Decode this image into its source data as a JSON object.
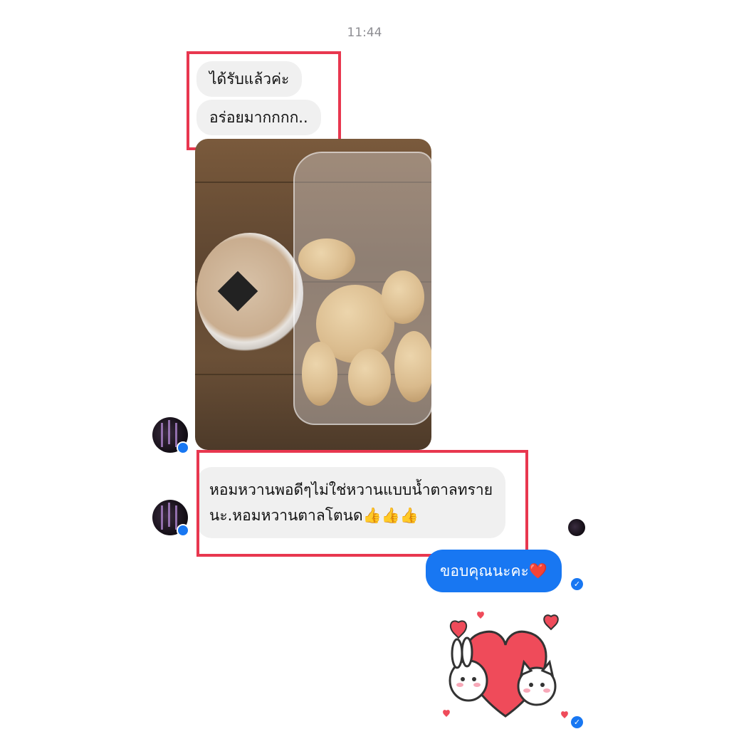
{
  "chat": {
    "timestamp": "11:44",
    "incoming": [
      {
        "text": "ได้รับแล้วค่ะ"
      },
      {
        "text": "อร่อยมากกกก.."
      }
    ],
    "photo": {
      "description_icon": "food-photo"
    },
    "review": {
      "line1": "หอมหวานพอดีๆไม่ใช่หวานแบบน้ำตาลทราย",
      "line2": "นะ.หอมหวานตาลโตนด👍👍👍"
    },
    "outgoing": {
      "text": "ขอบคุณนะคะ❤️"
    }
  },
  "icons": {
    "avatar": "avatar",
    "messenger_badge": "messenger-icon",
    "seen_indicator": "check-icon",
    "sticker": "heart-bunnies-sticker"
  },
  "colors": {
    "outgoing_bubble": "#1877f2",
    "incoming_bubble": "#f0f0f0",
    "highlight_border": "#e8374f"
  }
}
